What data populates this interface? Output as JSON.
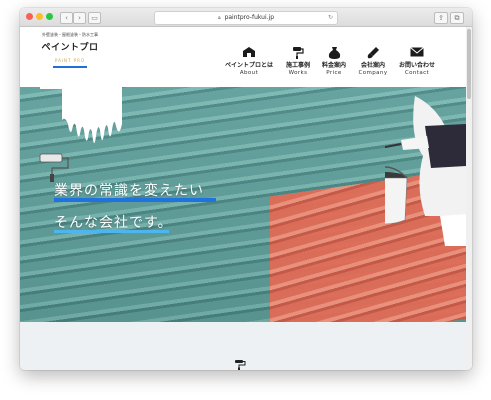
{
  "browser": {
    "url": "paintpro-fukui.jp",
    "back": "‹",
    "forward": "›"
  },
  "logo": {
    "tagline": "外壁塗装・屋根塗装・防水工事",
    "name": "ペイントプロ",
    "sub": "PAINT PRO"
  },
  "nav": [
    {
      "jp": "ペイントプロとは",
      "en": "About",
      "icon": "building-icon"
    },
    {
      "jp": "施工事例",
      "en": "Works",
      "icon": "paint-roller-icon"
    },
    {
      "jp": "料金案内",
      "en": "Price",
      "icon": "money-bag-icon"
    },
    {
      "jp": "会社案内",
      "en": "Company",
      "icon": "brush-icon"
    },
    {
      "jp": "お問い合わせ",
      "en": "Contact",
      "icon": "envelope-icon"
    }
  ],
  "hero": {
    "line1": "業界の常識を変えたい",
    "line2": "そんな会社です。"
  },
  "colors": {
    "accent_blue": "#1f73e0",
    "accent_light_blue": "#4db6ef",
    "roof_teal": "#5f9f9b",
    "roof_coral": "#e16b56"
  }
}
